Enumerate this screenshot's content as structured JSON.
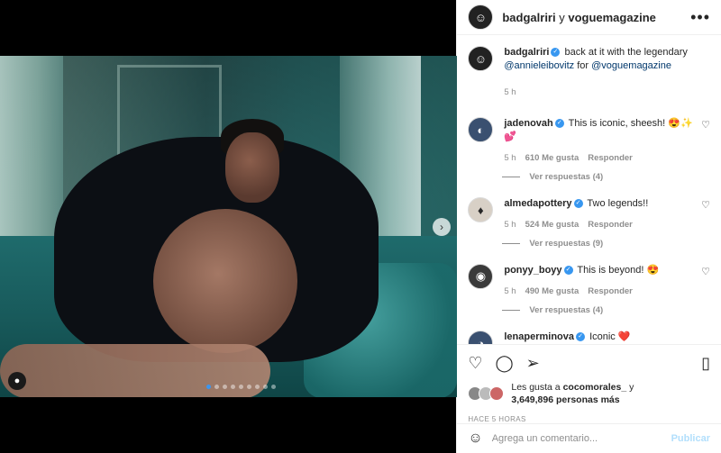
{
  "header": {
    "author": "badgalriri",
    "connector": " y ",
    "collab": "voguemagazine",
    "more_icon": "more-icon"
  },
  "caption": {
    "user": "badgalriri",
    "text_before": " back at it with the legendary ",
    "mention1": "@annieleibovitz",
    "mid": " for ",
    "mention2": "@voguemagazine",
    "time": "5 h"
  },
  "comments": [
    {
      "user": "jadenovah",
      "text": "This is iconic, sheesh! 😍✨💕",
      "time": "5 h",
      "likes": "610 Me gusta",
      "reply": "Responder",
      "replies": "Ver respuestas (4)"
    },
    {
      "user": "almedapottery",
      "text": "Two legends!!",
      "time": "5 h",
      "likes": "524 Me gusta",
      "reply": "Responder",
      "replies": "Ver respuestas (9)"
    },
    {
      "user": "ponyy_boyy",
      "text": "This is beyond! 😍",
      "time": "5 h",
      "likes": "490 Me gusta",
      "reply": "Responder",
      "replies": "Ver respuestas (4)"
    },
    {
      "user": "lenaperminova",
      "text": "Iconic ❤️"
    }
  ],
  "likes": {
    "prefix": "Les gusta a ",
    "user": "cocomorales_",
    "suffix": " y",
    "count": "3,649,896 personas más"
  },
  "timestamp": "HACE 5 HORAS",
  "composer": {
    "placeholder": "Agrega un comentario...",
    "publish": "Publicar"
  },
  "carousel": {
    "total": 9,
    "active": 0
  }
}
